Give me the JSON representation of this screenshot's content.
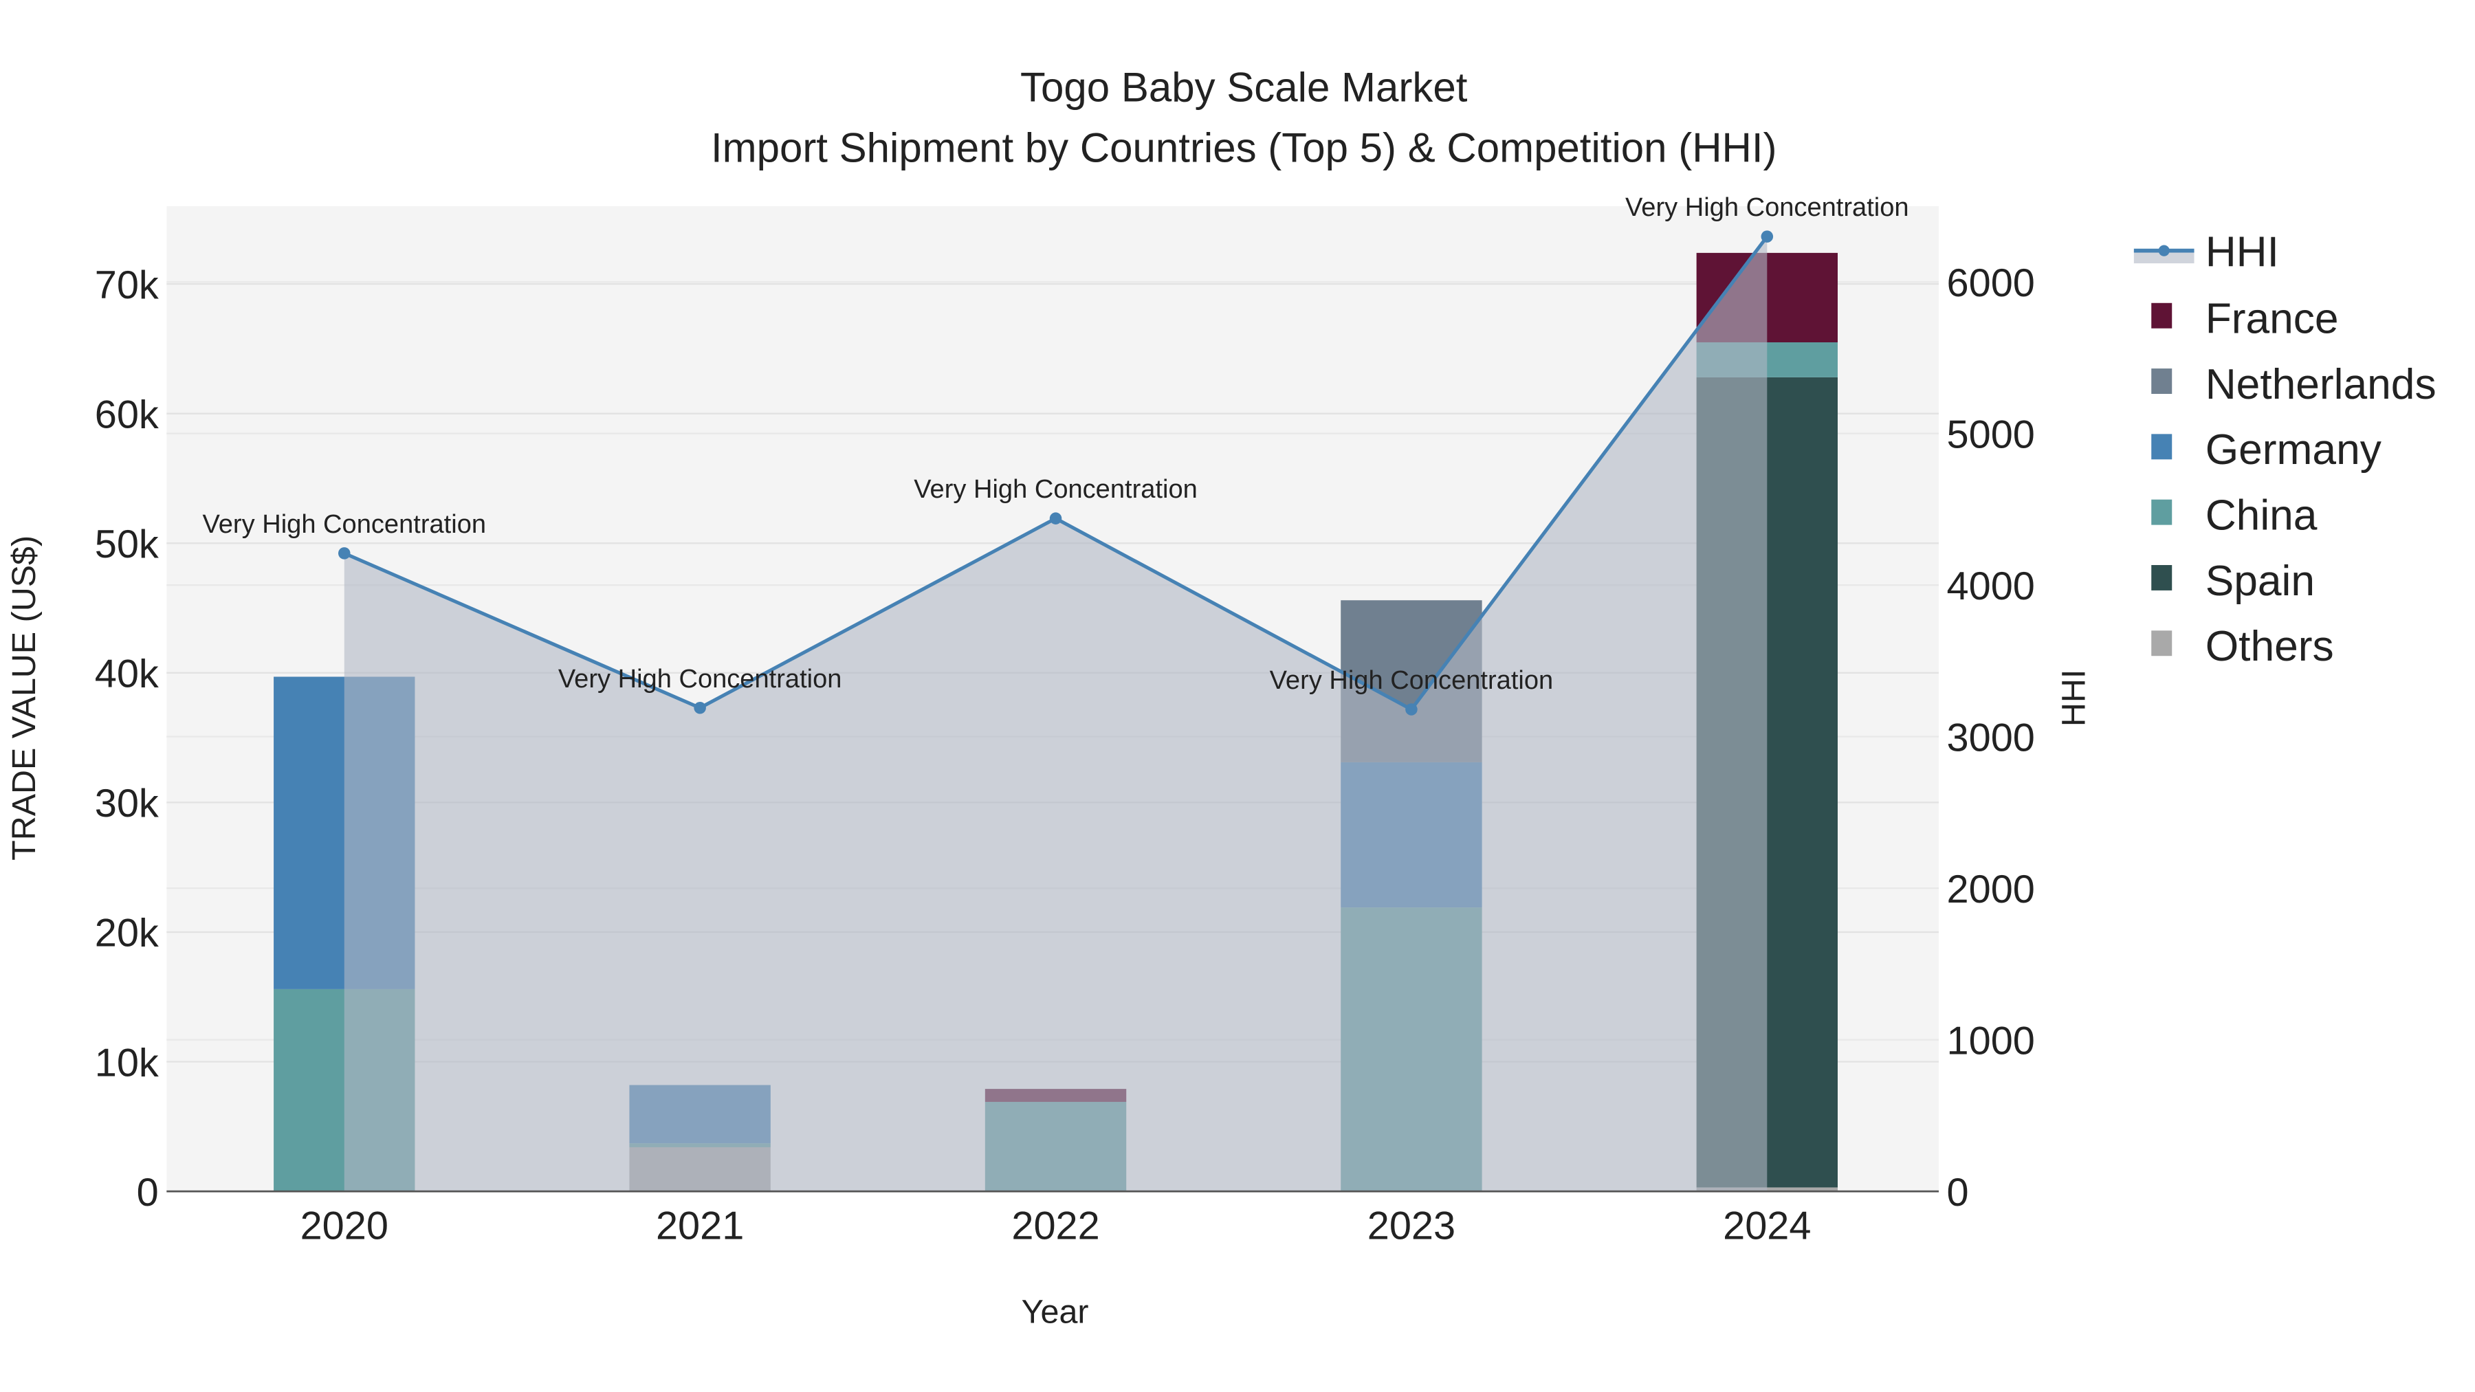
{
  "chart_data": {
    "type": "bar",
    "title": "Togo Baby Scale Market",
    "subtitle": "Import Shipment by Countries (Top 5) & Competition (HHI)",
    "xlabel": "Year",
    "ylabel": "TRADE VALUE (US$)",
    "y2label": "HHI",
    "categories": [
      "2020",
      "2021",
      "2022",
      "2023",
      "2024"
    ],
    "ylim": [
      0,
      76000
    ],
    "y2lim": [
      0,
      6500
    ],
    "yticks": [
      0,
      10000,
      20000,
      30000,
      40000,
      50000,
      60000,
      70000
    ],
    "ytick_labels": [
      "0",
      "10k",
      "20k",
      "30k",
      "40k",
      "50k",
      "60k",
      "70k"
    ],
    "y2ticks": [
      0,
      1000,
      2000,
      3000,
      4000,
      5000,
      6000
    ],
    "y2tick_labels": [
      "0",
      "1000",
      "2000",
      "3000",
      "4000",
      "5000",
      "6000"
    ],
    "grid": true,
    "legend_placement": "right",
    "stack_order": [
      "Others",
      "Spain",
      "China",
      "Germany",
      "Netherlands",
      "France"
    ],
    "series": [
      {
        "name": "France",
        "color": "#5f1335",
        "values": [
          0,
          0,
          1000,
          0,
          6900
        ]
      },
      {
        "name": "Netherlands",
        "color": "#708090",
        "values": [
          0,
          0,
          0,
          12500,
          0
        ]
      },
      {
        "name": "Germany",
        "color": "#4682b4",
        "values": [
          24100,
          4500,
          0,
          11200,
          0
        ]
      },
      {
        "name": "China",
        "color": "#5f9ea0",
        "values": [
          15600,
          300,
          6900,
          21900,
          2700
        ]
      },
      {
        "name": "Spain",
        "color": "#2f4f4f",
        "values": [
          0,
          0,
          0,
          0,
          62500
        ]
      },
      {
        "name": "Others",
        "color": "#a9a9a9",
        "values": [
          0,
          3400,
          0,
          0,
          300
        ]
      }
    ],
    "line": {
      "name": "HHI",
      "color": "#4682b4",
      "fill": "#b0b8c4",
      "values": [
        4210,
        3190,
        4440,
        3180,
        6300
      ],
      "annotations": [
        "Very High Concentration",
        "Very High Concentration",
        "Very High Concentration",
        "Very High Concentration",
        "Very High Concentration"
      ]
    },
    "legend": [
      "HHI",
      "France",
      "Netherlands",
      "Germany",
      "China",
      "Spain",
      "Others"
    ]
  }
}
